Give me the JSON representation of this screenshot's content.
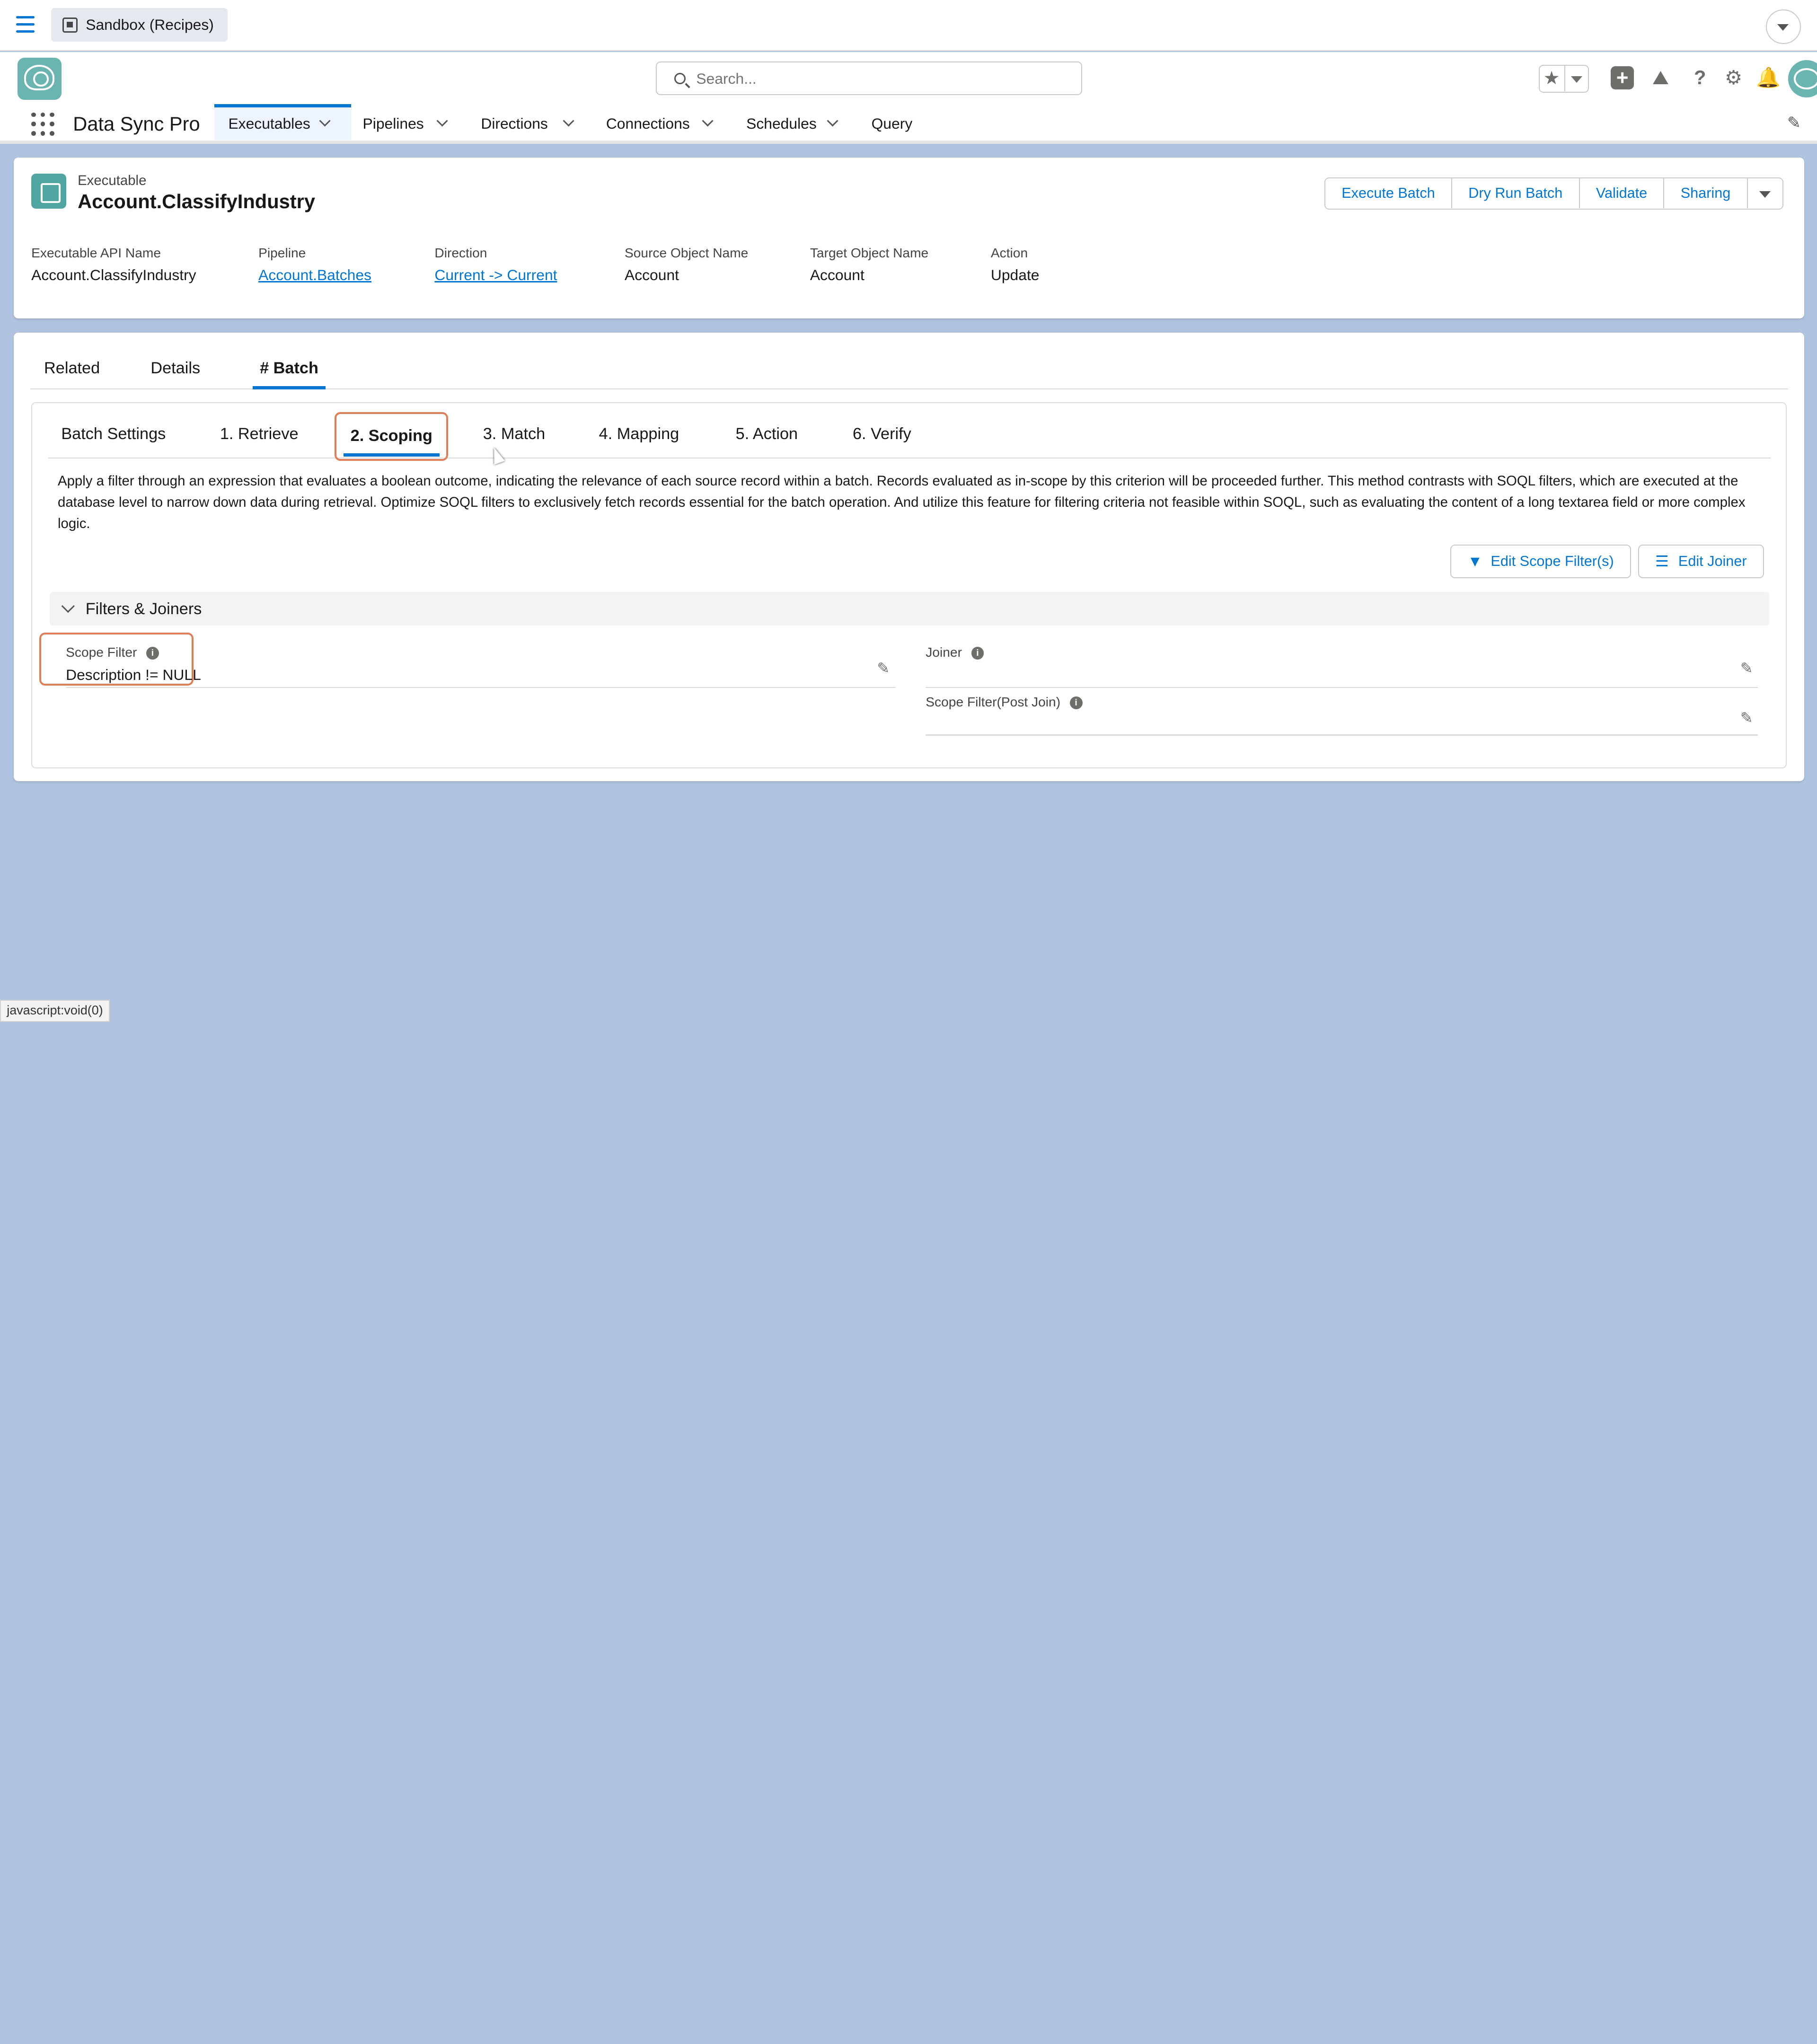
{
  "sandbox": {
    "label": "Sandbox (Recipes)"
  },
  "header": {
    "search_placeholder": "Search..."
  },
  "app": {
    "name": "Data Sync Pro",
    "nav": [
      {
        "label": "Executables",
        "active": true,
        "has_menu": true
      },
      {
        "label": "Pipelines",
        "has_menu": true
      },
      {
        "label": "Directions",
        "has_menu": true
      },
      {
        "label": "Connections",
        "has_menu": true
      },
      {
        "label": "Schedules",
        "has_menu": true
      },
      {
        "label": "Query",
        "has_menu": false
      }
    ]
  },
  "record": {
    "type": "Executable",
    "title": "Account.ClassifyIndustry",
    "actions": [
      "Execute Batch",
      "Dry Run Batch",
      "Validate",
      "Sharing"
    ],
    "fields": [
      {
        "label": "Executable API Name",
        "value": "Account.ClassifyIndustry",
        "link": false
      },
      {
        "label": "Pipeline",
        "value": "Account.Batches",
        "link": true
      },
      {
        "label": "Direction",
        "value": "Current -> Current",
        "link": true
      },
      {
        "label": "Source Object Name",
        "value": "Account",
        "link": false
      },
      {
        "label": "Target Object Name",
        "value": "Account",
        "link": false
      },
      {
        "label": "Action",
        "value": "Update",
        "link": false
      }
    ]
  },
  "tabs": [
    "Related",
    "Details",
    "# Batch"
  ],
  "active_tab": "# Batch",
  "sub_tabs": [
    "Batch Settings",
    "1. Retrieve",
    "2. Scoping",
    "3. Match",
    "4. Mapping",
    "5. Action",
    "6. Verify"
  ],
  "active_sub_tab": "2. Scoping",
  "scoping": {
    "description": "Apply a filter through an expression that evaluates a boolean outcome, indicating the relevance of each source record within a batch. Records evaluated as in-scope by this criterion will be proceeded further. This method contrasts with SOQL filters, which are executed at the database level to narrow down data during retrieval. Optimize SOQL filters to exclusively fetch records essential for the batch operation. And utilize this feature for filtering criteria not feasible within SOQL, such as evaluating the content of a long textarea field or more complex logic.",
    "edit_scope_button": "Edit Scope Filter(s)",
    "edit_joiner_button": "Edit Joiner",
    "section_title": "Filters & Joiners",
    "scope_filter": {
      "label": "Scope Filter",
      "value": "Description != NULL"
    },
    "joiner": {
      "label": "Joiner",
      "value": ""
    },
    "scope_filter_post_join": {
      "label": "Scope Filter(Post Join)",
      "value": ""
    }
  },
  "status_bar": {
    "url": "javascript:void(0)"
  },
  "colors": {
    "accent": "#0176d3",
    "highlight": "#e07f56",
    "background": "#b0c4df"
  }
}
